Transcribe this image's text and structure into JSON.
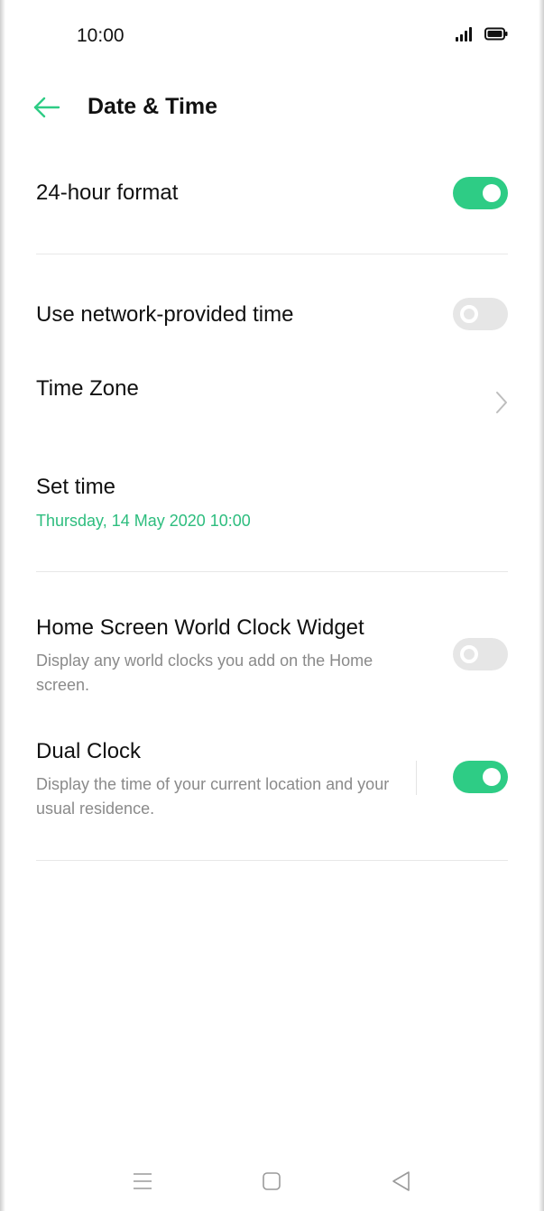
{
  "status_bar": {
    "time": "10:00",
    "icons": [
      "signal-icon",
      "battery-icon"
    ]
  },
  "header": {
    "title": "Date & Time",
    "back_icon": "arrow-left-icon"
  },
  "settings": {
    "hour_format": {
      "title": "24-hour format",
      "enabled": true
    },
    "network_time": {
      "title": "Use network-provided time",
      "enabled": false
    },
    "time_zone": {
      "title": "Time Zone",
      "icon": "chevron-right-icon"
    },
    "set_time": {
      "title": "Set time",
      "value": "Thursday, 14 May 2020  10:00"
    },
    "world_clock_widget": {
      "title": "Home Screen World Clock Widget",
      "description": "Display any world clocks you add on the Home screen.",
      "enabled": false
    },
    "dual_clock": {
      "title": "Dual Clock",
      "description": "Display the time of your current location and your usual residence.",
      "enabled": true
    }
  },
  "nav_bar": {
    "icons": [
      "menu-icon",
      "home-icon",
      "back-icon"
    ]
  },
  "colors": {
    "accent": "#2ecc85",
    "accent_text": "#2dbd7e",
    "toggle_off": "#e6e6e6"
  }
}
